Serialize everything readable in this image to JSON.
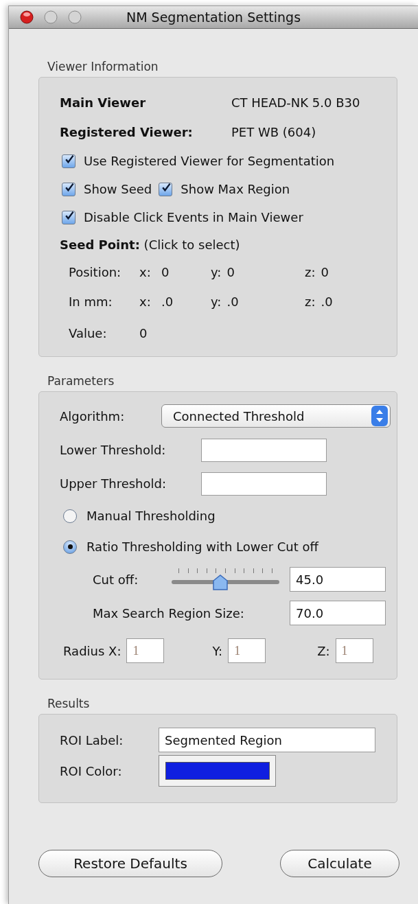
{
  "window": {
    "title": "NM Segmentation Settings"
  },
  "viewer_information": {
    "title": "Viewer Information",
    "main_viewer": {
      "label": "Main Viewer",
      "value": "CT HEAD-NK 5.0 B30"
    },
    "registered_viewer": {
      "label": "Registered Viewer:",
      "value": "PET WB (604)"
    },
    "checkbox_rows": [
      [
        {
          "label": "Use Registered Viewer for Segmentation",
          "checked": true
        }
      ],
      [
        {
          "label": "Show Seed",
          "checked": true
        },
        {
          "label": "Show Max Region",
          "checked": true
        }
      ],
      [
        {
          "label": "Disable Click Events in Main Viewer",
          "checked": true
        }
      ]
    ],
    "seed_point": "**Seed Point:** (Click to select)",
    "coordinates": [
      {
        "label": "Position:",
        "cells": [
          {
            "axis": "x:",
            "value": "0"
          },
          {
            "axis": "y:",
            "value": "0"
          },
          {
            "axis": "z:",
            "value": "0"
          }
        ]
      },
      {
        "label": "In mm:",
        "cells": [
          {
            "axis": "x:",
            "value": ".0"
          },
          {
            "axis": "y:",
            "value": ".0"
          },
          {
            "axis": "z:",
            "value": ".0"
          }
        ]
      },
      {
        "label": "Value:",
        "cells": [
          {
            "value": "0"
          }
        ]
      }
    ]
  },
  "parameters": {
    "title": "Parameters",
    "algorithm": {
      "label": "Algorithm:",
      "value": "Connected Threshold"
    },
    "thresholds": [
      {
        "label": "Lower Threshold:"
      },
      {
        "label": "Upper Threshold:"
      }
    ],
    "modes": [
      {
        "label": "Manual Thresholding",
        "selected": false
      },
      {
        "label": "Ratio Thresholding with Lower Cut off",
        "selected": true
      }
    ],
    "cut_off": {
      "label": "Cut off:",
      "level": 0.45,
      "value": "45.0"
    },
    "max_search_region": {
      "label": "Max Search Region Size:",
      "value": "70.0"
    },
    "radius": [
      {
        "label": "Radius X:",
        "value": "1",
        "disabled": true
      },
      {
        "label": "Y:",
        "value": "1",
        "disabled": true
      },
      {
        "label": "Z:",
        "value": "1",
        "disabled": true
      }
    ]
  },
  "results": {
    "title": "Results",
    "roi_label": {
      "label": "ROI Label:",
      "value": "Segmented Region"
    },
    "roi_color": {
      "label": "ROI Color:",
      "color": "#0f1fe0"
    }
  },
  "buttons": [
    {
      "label": "Restore Defaults"
    },
    {
      "label": "Calculate"
    }
  ]
}
